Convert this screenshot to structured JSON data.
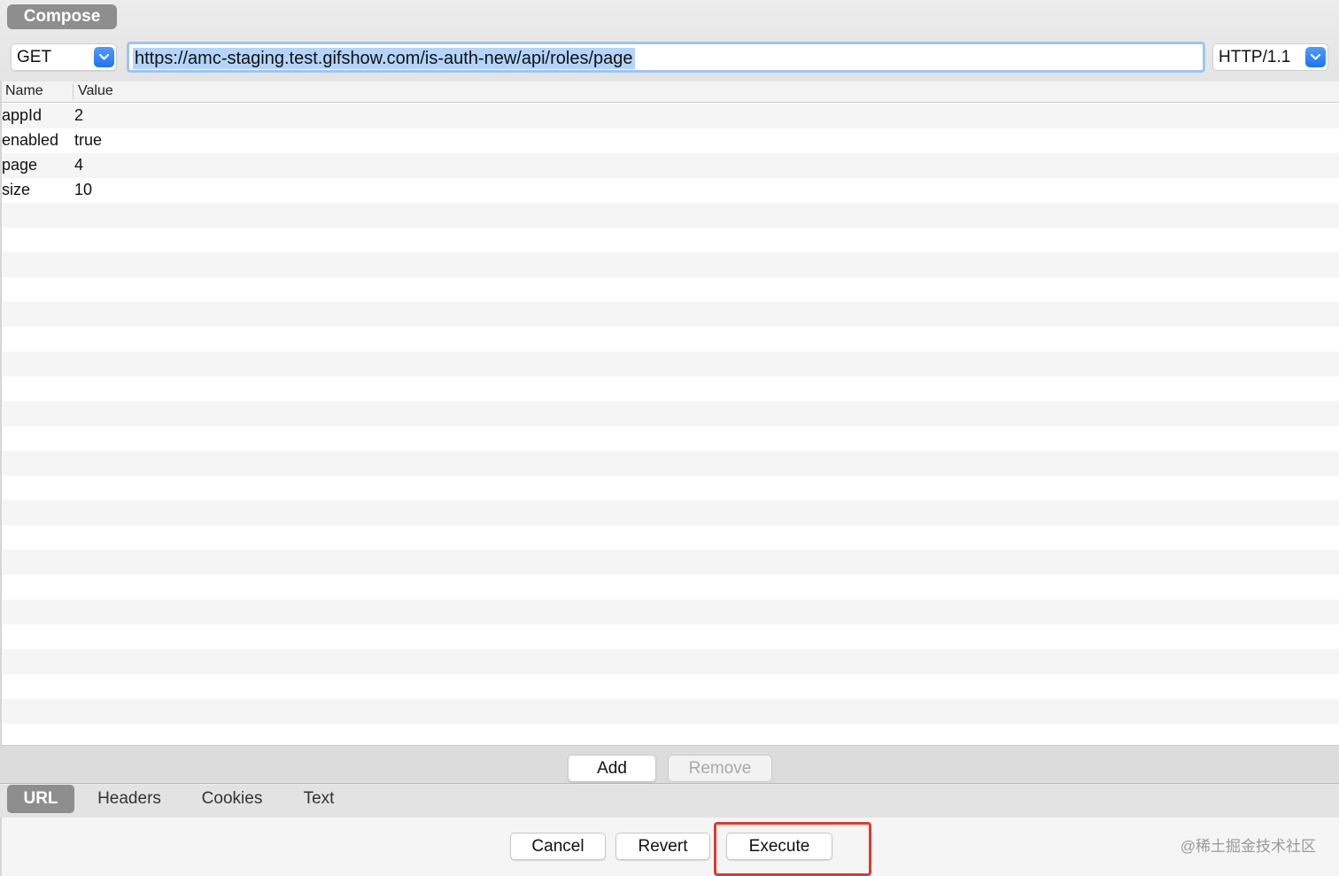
{
  "compose_tab": {
    "label": "Compose"
  },
  "request": {
    "method": "GET",
    "url": "https://amc-staging.test.gifshow.com/is-auth-new/api/roles/page",
    "protocol": "HTTP/1.1"
  },
  "params_table": {
    "columns": [
      "Name",
      "Value"
    ],
    "rows": [
      {
        "name": "appId",
        "value": "2"
      },
      {
        "name": "enabled",
        "value": "true"
      },
      {
        "name": "page",
        "value": "4"
      },
      {
        "name": "size",
        "value": "10"
      }
    ]
  },
  "table_actions": {
    "add": "Add",
    "remove": "Remove"
  },
  "tabs": [
    {
      "label": "URL",
      "active": true
    },
    {
      "label": "Headers",
      "active": false
    },
    {
      "label": "Cookies",
      "active": false
    },
    {
      "label": "Text",
      "active": false
    }
  ],
  "footer": {
    "cancel": "Cancel",
    "revert": "Revert",
    "execute": "Execute"
  },
  "watermark": "@稀土掘金技术社区",
  "icons": {
    "dropdown": "chevron-down-icon"
  },
  "colors": {
    "accent": "#1e75f0",
    "highlight": "#e0392f",
    "tab_active": "#8e8e8e"
  }
}
